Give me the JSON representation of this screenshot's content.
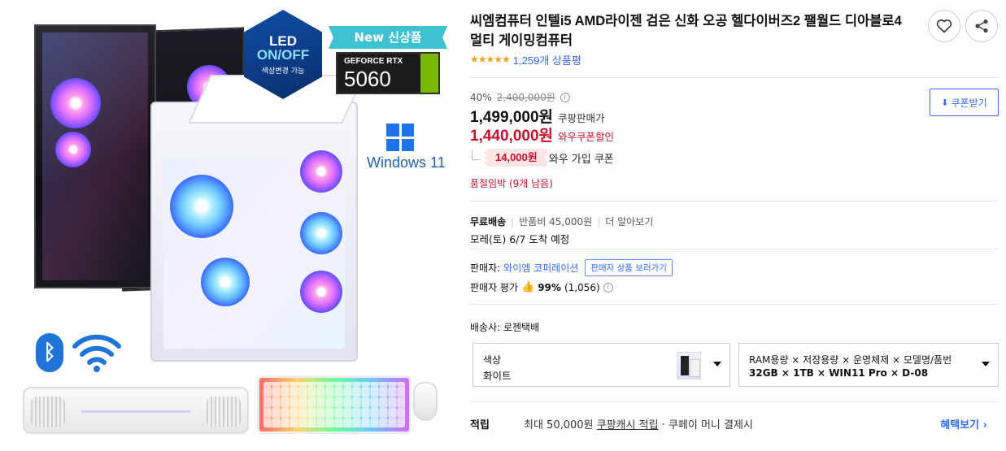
{
  "product": {
    "title": "씨엠컴퓨터 인텔i5 AMD라이젠 검은 신화 오공 헬다이버즈2 팰월드 디아블로4 멀티 게이밍컴퓨터",
    "rating_stars": "★★★★★",
    "review_count": "1,259개 상품평"
  },
  "image_badges": {
    "led_line1": "LED",
    "led_line2": "ON/OFF",
    "led_line3": "색상변경 가능",
    "new_label": "New 신상품",
    "gpu_brand": "GEFORCE RTX",
    "gpu_model": "5060",
    "os_label": "Windows 11",
    "bluetooth_glyph": "ᛒ"
  },
  "pricing": {
    "discount_rate": "40%",
    "original_price": "2,400,000원",
    "info_glyph": "i",
    "sale_price": "1,499,000원",
    "sale_label": "쿠팡판매가",
    "wow_price": "1,440,000원",
    "wow_label": "와우쿠폰할인",
    "coupon_amount": "14,000원",
    "coupon_label": "와우 가입 쿠폰",
    "stock_note": "품절임박 (9개 남음)",
    "coupon_button": "쿠폰받기",
    "coupon_button_icon": "⬇"
  },
  "shipping": {
    "free": "무료배송",
    "return_fee": "반품비 45,000원",
    "more": "더 알아보기",
    "arrival": "모레(토) 6/7 도착 예정"
  },
  "seller": {
    "label": "판매자:",
    "name": "와이엠 코퍼레이션",
    "go_button": "판매자 상품 보러가기",
    "eval_label": "판매자 평가",
    "eval_score": "99%",
    "eval_count": "(1,056)",
    "carrier": "배송사: 로젠택배"
  },
  "options": [
    {
      "label": "색상",
      "value": "화이트"
    },
    {
      "label": "RAM용량 × 저장용량 × 운영체제 × 모델명/품번",
      "value": "32GB × 1TB × WIN11 Pro × D-08"
    }
  ],
  "reward": {
    "label": "적립",
    "text_prefix": "최대 50,000원 ",
    "text_link": "쿠팡캐시 적립",
    "text_suffix": " · 쿠페이 머니 결제시",
    "benefit_link": "혜택보기 ›"
  },
  "colors": {
    "accent": "#346aff",
    "price_red": "#c8102e",
    "star": "#f6a01a"
  }
}
